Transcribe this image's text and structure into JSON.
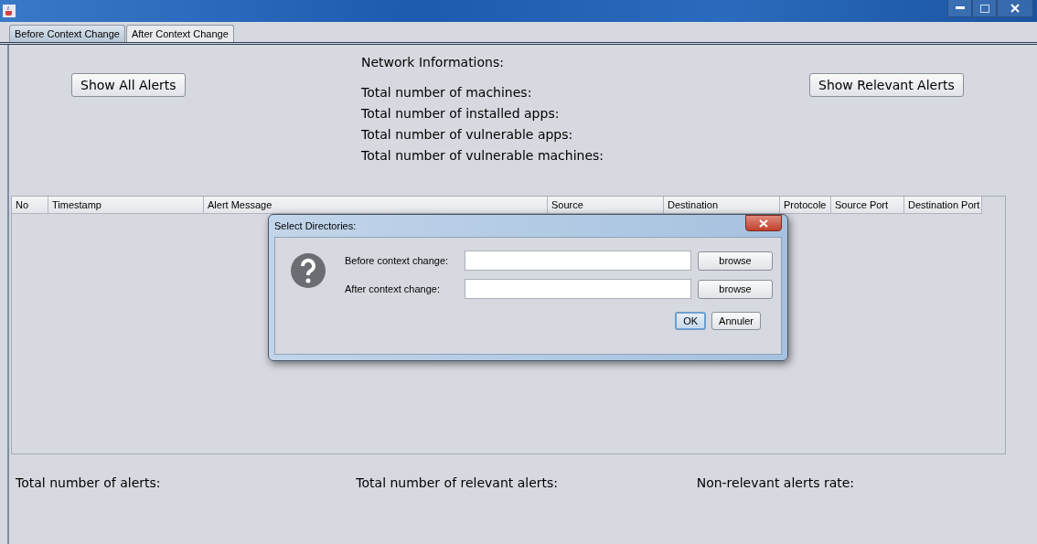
{
  "tabs": [
    {
      "label": "Before Context Change",
      "selected": true
    },
    {
      "label": "After Context Change",
      "selected": false
    }
  ],
  "buttons": [
    "Show All Alerts",
    "Show Relevant Alerts"
  ],
  "network_info": {
    "title": "Network Informations:",
    "lines": [
      "Total number of machines:",
      "Total number of installed apps:",
      "Total number of vulnerable apps:",
      "Total number of vulnerable machines:"
    ]
  },
  "table": {
    "columns": [
      "No",
      "Timestamp",
      "Alert Message",
      "Source",
      "Destination",
      "Protocole",
      "Source Port",
      "Destination Port"
    ]
  },
  "summary": [
    "Total number of alerts:",
    "Total number of relevant alerts:",
    "Non-relevant alerts rate:"
  ],
  "dialog": {
    "title": "Select Directories:",
    "fields": [
      {
        "label": "Before context change:",
        "button": "browse"
      },
      {
        "label": "After context change:",
        "button": "browse"
      }
    ],
    "buttons": [
      {
        "label": "OK",
        "selected": true
      },
      {
        "label": "Annuler",
        "selected": false
      }
    ]
  }
}
